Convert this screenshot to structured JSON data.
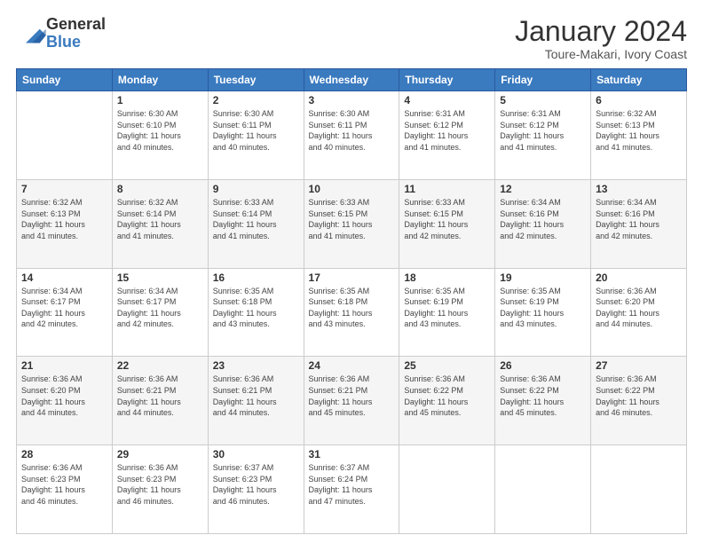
{
  "header": {
    "logo_general": "General",
    "logo_blue": "Blue",
    "month_title": "January 2024",
    "subtitle": "Toure-Makari, Ivory Coast"
  },
  "weekdays": [
    "Sunday",
    "Monday",
    "Tuesday",
    "Wednesday",
    "Thursday",
    "Friday",
    "Saturday"
  ],
  "weeks": [
    [
      {
        "day": "",
        "sunrise": "",
        "sunset": "",
        "daylight": ""
      },
      {
        "day": "1",
        "sunrise": "Sunrise: 6:30 AM",
        "sunset": "Sunset: 6:10 PM",
        "daylight": "Daylight: 11 hours and 40 minutes."
      },
      {
        "day": "2",
        "sunrise": "Sunrise: 6:30 AM",
        "sunset": "Sunset: 6:11 PM",
        "daylight": "Daylight: 11 hours and 40 minutes."
      },
      {
        "day": "3",
        "sunrise": "Sunrise: 6:30 AM",
        "sunset": "Sunset: 6:11 PM",
        "daylight": "Daylight: 11 hours and 40 minutes."
      },
      {
        "day": "4",
        "sunrise": "Sunrise: 6:31 AM",
        "sunset": "Sunset: 6:12 PM",
        "daylight": "Daylight: 11 hours and 41 minutes."
      },
      {
        "day": "5",
        "sunrise": "Sunrise: 6:31 AM",
        "sunset": "Sunset: 6:12 PM",
        "daylight": "Daylight: 11 hours and 41 minutes."
      },
      {
        "day": "6",
        "sunrise": "Sunrise: 6:32 AM",
        "sunset": "Sunset: 6:13 PM",
        "daylight": "Daylight: 11 hours and 41 minutes."
      }
    ],
    [
      {
        "day": "7",
        "sunrise": "Sunrise: 6:32 AM",
        "sunset": "Sunset: 6:13 PM",
        "daylight": "Daylight: 11 hours and 41 minutes."
      },
      {
        "day": "8",
        "sunrise": "Sunrise: 6:32 AM",
        "sunset": "Sunset: 6:14 PM",
        "daylight": "Daylight: 11 hours and 41 minutes."
      },
      {
        "day": "9",
        "sunrise": "Sunrise: 6:33 AM",
        "sunset": "Sunset: 6:14 PM",
        "daylight": "Daylight: 11 hours and 41 minutes."
      },
      {
        "day": "10",
        "sunrise": "Sunrise: 6:33 AM",
        "sunset": "Sunset: 6:15 PM",
        "daylight": "Daylight: 11 hours and 41 minutes."
      },
      {
        "day": "11",
        "sunrise": "Sunrise: 6:33 AM",
        "sunset": "Sunset: 6:15 PM",
        "daylight": "Daylight: 11 hours and 42 minutes."
      },
      {
        "day": "12",
        "sunrise": "Sunrise: 6:34 AM",
        "sunset": "Sunset: 6:16 PM",
        "daylight": "Daylight: 11 hours and 42 minutes."
      },
      {
        "day": "13",
        "sunrise": "Sunrise: 6:34 AM",
        "sunset": "Sunset: 6:16 PM",
        "daylight": "Daylight: 11 hours and 42 minutes."
      }
    ],
    [
      {
        "day": "14",
        "sunrise": "Sunrise: 6:34 AM",
        "sunset": "Sunset: 6:17 PM",
        "daylight": "Daylight: 11 hours and 42 minutes."
      },
      {
        "day": "15",
        "sunrise": "Sunrise: 6:34 AM",
        "sunset": "Sunset: 6:17 PM",
        "daylight": "Daylight: 11 hours and 42 minutes."
      },
      {
        "day": "16",
        "sunrise": "Sunrise: 6:35 AM",
        "sunset": "Sunset: 6:18 PM",
        "daylight": "Daylight: 11 hours and 43 minutes."
      },
      {
        "day": "17",
        "sunrise": "Sunrise: 6:35 AM",
        "sunset": "Sunset: 6:18 PM",
        "daylight": "Daylight: 11 hours and 43 minutes."
      },
      {
        "day": "18",
        "sunrise": "Sunrise: 6:35 AM",
        "sunset": "Sunset: 6:19 PM",
        "daylight": "Daylight: 11 hours and 43 minutes."
      },
      {
        "day": "19",
        "sunrise": "Sunrise: 6:35 AM",
        "sunset": "Sunset: 6:19 PM",
        "daylight": "Daylight: 11 hours and 43 minutes."
      },
      {
        "day": "20",
        "sunrise": "Sunrise: 6:36 AM",
        "sunset": "Sunset: 6:20 PM",
        "daylight": "Daylight: 11 hours and 44 minutes."
      }
    ],
    [
      {
        "day": "21",
        "sunrise": "Sunrise: 6:36 AM",
        "sunset": "Sunset: 6:20 PM",
        "daylight": "Daylight: 11 hours and 44 minutes."
      },
      {
        "day": "22",
        "sunrise": "Sunrise: 6:36 AM",
        "sunset": "Sunset: 6:21 PM",
        "daylight": "Daylight: 11 hours and 44 minutes."
      },
      {
        "day": "23",
        "sunrise": "Sunrise: 6:36 AM",
        "sunset": "Sunset: 6:21 PM",
        "daylight": "Daylight: 11 hours and 44 minutes."
      },
      {
        "day": "24",
        "sunrise": "Sunrise: 6:36 AM",
        "sunset": "Sunset: 6:21 PM",
        "daylight": "Daylight: 11 hours and 45 minutes."
      },
      {
        "day": "25",
        "sunrise": "Sunrise: 6:36 AM",
        "sunset": "Sunset: 6:22 PM",
        "daylight": "Daylight: 11 hours and 45 minutes."
      },
      {
        "day": "26",
        "sunrise": "Sunrise: 6:36 AM",
        "sunset": "Sunset: 6:22 PM",
        "daylight": "Daylight: 11 hours and 45 minutes."
      },
      {
        "day": "27",
        "sunrise": "Sunrise: 6:36 AM",
        "sunset": "Sunset: 6:22 PM",
        "daylight": "Daylight: 11 hours and 46 minutes."
      }
    ],
    [
      {
        "day": "28",
        "sunrise": "Sunrise: 6:36 AM",
        "sunset": "Sunset: 6:23 PM",
        "daylight": "Daylight: 11 hours and 46 minutes."
      },
      {
        "day": "29",
        "sunrise": "Sunrise: 6:36 AM",
        "sunset": "Sunset: 6:23 PM",
        "daylight": "Daylight: 11 hours and 46 minutes."
      },
      {
        "day": "30",
        "sunrise": "Sunrise: 6:37 AM",
        "sunset": "Sunset: 6:23 PM",
        "daylight": "Daylight: 11 hours and 46 minutes."
      },
      {
        "day": "31",
        "sunrise": "Sunrise: 6:37 AM",
        "sunset": "Sunset: 6:24 PM",
        "daylight": "Daylight: 11 hours and 47 minutes."
      },
      {
        "day": "",
        "sunrise": "",
        "sunset": "",
        "daylight": ""
      },
      {
        "day": "",
        "sunrise": "",
        "sunset": "",
        "daylight": ""
      },
      {
        "day": "",
        "sunrise": "",
        "sunset": "",
        "daylight": ""
      }
    ]
  ]
}
